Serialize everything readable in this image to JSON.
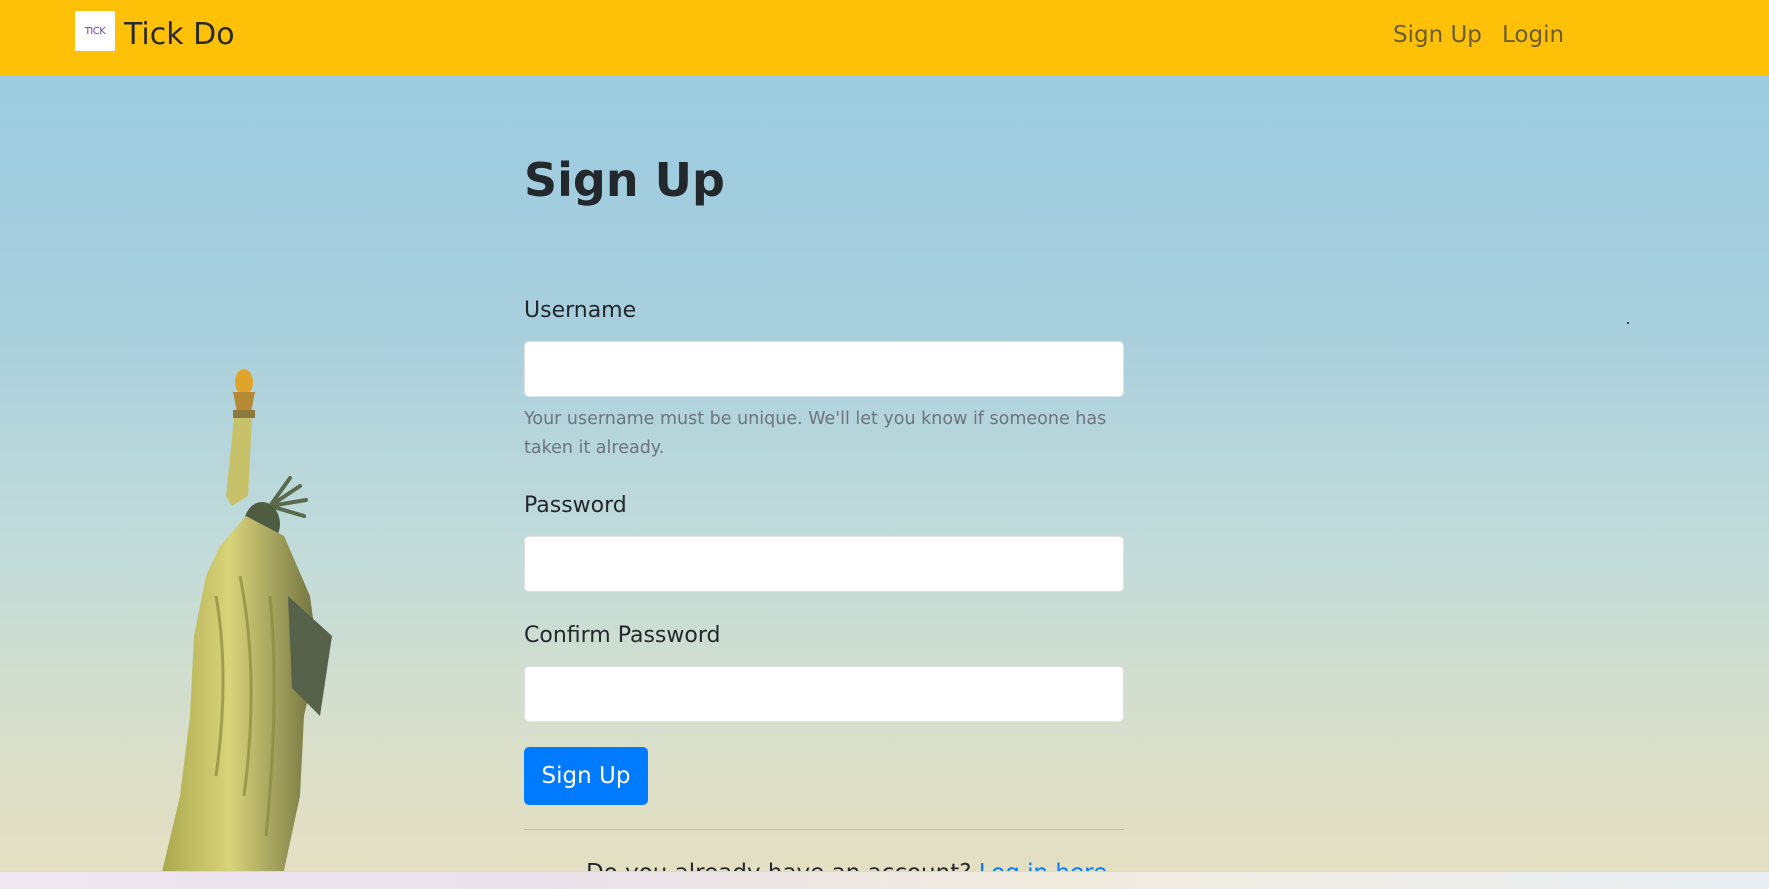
{
  "navbar": {
    "logo_text": "TICK",
    "brand": "Tick Do",
    "links": [
      "Sign Up",
      "Login"
    ],
    "background_color": "#ffc107"
  },
  "form": {
    "title": "Sign Up",
    "username": {
      "label": "Username",
      "value": "",
      "help": "Your username must be unique. We'll let you know if someone has taken it already."
    },
    "password": {
      "label": "Password",
      "value": ""
    },
    "confirm_password": {
      "label": "Confirm Password",
      "value": ""
    },
    "submit_label": "Sign Up",
    "submit_color": "#007bff",
    "footer_prompt": "Do you already have an account?",
    "footer_link": "Log in here"
  },
  "background": {
    "image_subject": "statue-of-liberty",
    "sky_colors": [
      "#9ccbe0",
      "#e4dfc2"
    ]
  }
}
